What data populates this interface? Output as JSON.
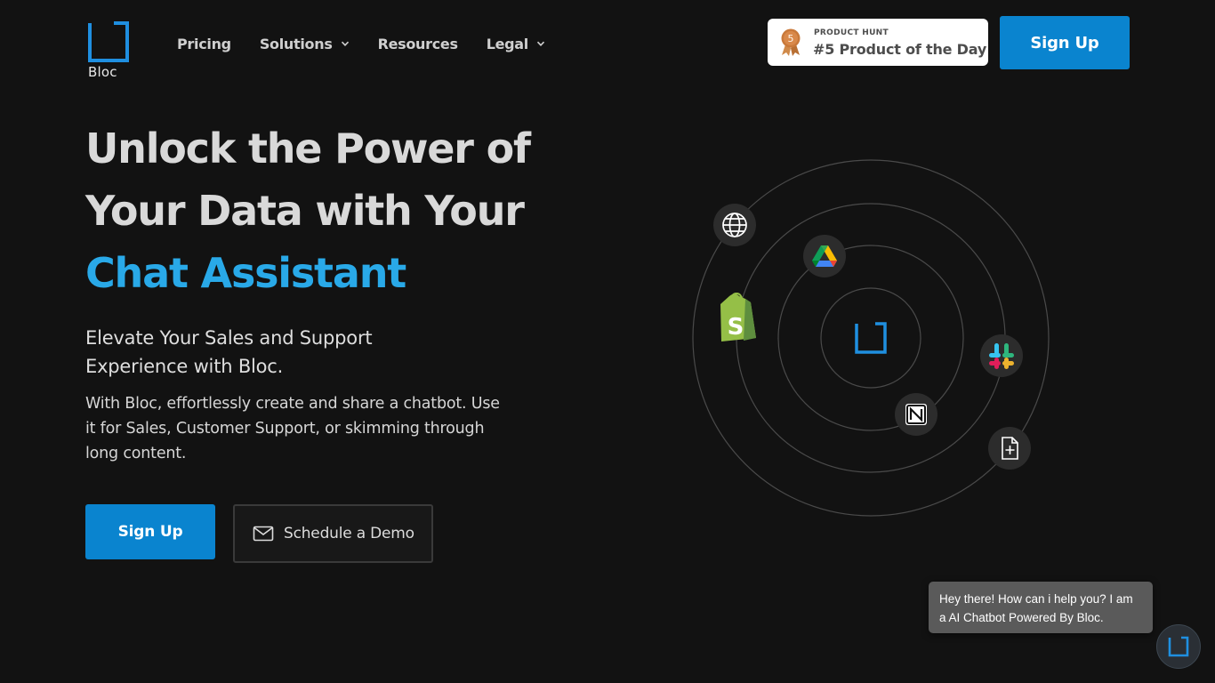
{
  "brand": {
    "name": "Bloc",
    "accent": "#29a9e8",
    "primary_button": "#0a84cf"
  },
  "nav": {
    "items": [
      {
        "label": "Pricing",
        "has_dropdown": false
      },
      {
        "label": "Solutions",
        "has_dropdown": true
      },
      {
        "label": "Resources",
        "has_dropdown": false
      },
      {
        "label": "Legal",
        "has_dropdown": true
      }
    ]
  },
  "product_hunt": {
    "rank": "5",
    "small_label": "PRODUCT HUNT",
    "label": "#5 Product of the Day"
  },
  "header": {
    "signup_label": "Sign Up"
  },
  "hero": {
    "title_line1": "Unlock the Power of",
    "title_line2": "Your Data with Your",
    "title_accent": "Chat Assistant",
    "subtitle": "Elevate Your Sales and Support Experience with Bloc.",
    "description": "With Bloc, effortlessly create and share a chatbot. Use it for Sales, Customer Support, or skimming through long content.",
    "signup_label": "Sign Up",
    "demo_label": "Schedule a Demo"
  },
  "integrations": [
    "globe-icon",
    "google-drive-icon",
    "shopify-icon",
    "slack-icon",
    "notion-icon",
    "file-add-icon"
  ],
  "chat": {
    "message": "Hey there! How can i help you? I am a AI Chatbot Powered By Bloc."
  }
}
